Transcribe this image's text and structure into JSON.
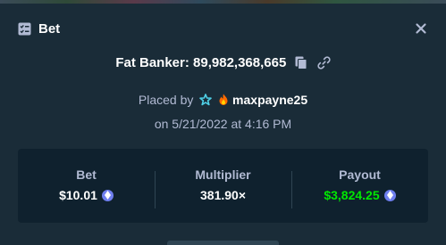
{
  "window": {
    "title": "Bet"
  },
  "icons": {
    "header": "bet-slip-icon",
    "close": "close-icon",
    "copy": "copy-icon",
    "link": "link-icon",
    "star_badge": "star-badge-icon",
    "fire_badge": "fire-icon",
    "currency": "ethereum-icon"
  },
  "game": {
    "name": "Fat Banker:",
    "id": "89,982,368,665"
  },
  "placed": {
    "prefix": "Placed by",
    "username": "maxpayne25",
    "date": "on 5/21/2022 at 4:16 PM"
  },
  "stats": {
    "bet_label": "Bet",
    "bet_value": "$10.01",
    "multiplier_label": "Multiplier",
    "multiplier_value": "381.90×",
    "payout_label": "Payout",
    "payout_value": "$3,824.25"
  },
  "colors": {
    "background": "#1a2c38",
    "panel": "#0f212e",
    "muted_text": "#b1bad3",
    "payout_green": "#00e701",
    "coin": "#6f7ff0"
  }
}
